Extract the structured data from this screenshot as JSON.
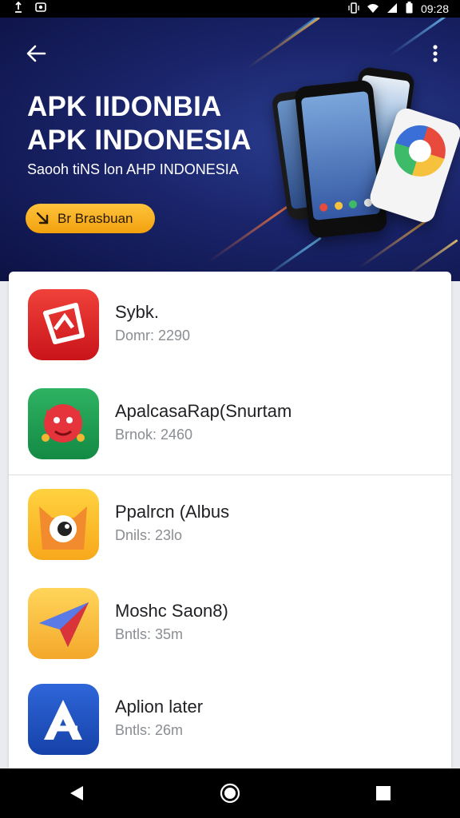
{
  "status_bar": {
    "time": "09:28"
  },
  "hero": {
    "title_line1": "APK IIDONBIA",
    "title_line2": "APK INDONESIA",
    "subtitle": "Saooh tiNS lon AHP INDONESIA",
    "cta_label": "Br Brasbuan"
  },
  "apps": [
    {
      "name": "Sybk.",
      "meta": "Domr: 2290",
      "icon": "red-app-icon"
    },
    {
      "name": "ApalcasaRap(Snurtam",
      "meta": "Brnok: 2460",
      "icon": "green-monster-app-icon"
    },
    {
      "name": "Ppalrcn (Albus",
      "meta": "Dnils: 23lo",
      "icon": "orange-eye-app-icon"
    },
    {
      "name": "Moshc Saon8)",
      "meta": "Bntls: 35m",
      "icon": "paper-plane-app-icon"
    },
    {
      "name": "Aplion later",
      "meta": "Bntls: 26m",
      "icon": "blue-a-app-icon"
    }
  ],
  "colors": {
    "hero_bg": "#1a246a",
    "cta": "#f7b52a",
    "text_primary": "#202124",
    "text_secondary": "#8a8d92"
  }
}
